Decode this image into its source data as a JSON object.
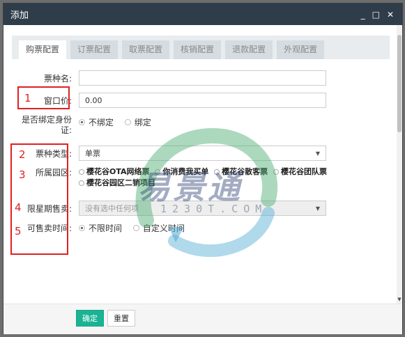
{
  "window": {
    "title": "添加",
    "controls": [
      "_",
      "□",
      "✕"
    ]
  },
  "tabs": [
    {
      "label": "购票配置",
      "active": true
    },
    {
      "label": "订票配置",
      "active": false
    },
    {
      "label": "取票配置",
      "active": false
    },
    {
      "label": "核销配置",
      "active": false
    },
    {
      "label": "退款配置",
      "active": false
    },
    {
      "label": "外观配置",
      "active": false
    }
  ],
  "form": {
    "ticket_name": {
      "label": "票种名:",
      "value": ""
    },
    "window_price": {
      "label": "窗口价:",
      "value": "0.00"
    },
    "bind_id": {
      "label": "是否绑定身份证:",
      "options": [
        "不绑定",
        "绑定"
      ],
      "selected": "不绑定"
    },
    "ticket_type": {
      "label": "票种类型:",
      "value": "单票"
    },
    "park": {
      "label": "所属园区:",
      "options": [
        "樱花谷OTA网络票",
        "你消费我买单",
        "樱花谷散客票",
        "樱花谷团队票",
        "樱花谷园区二销项目"
      ]
    },
    "weekday_limit": {
      "label": "限星期售卖:",
      "placeholder": "没有选中任何项"
    },
    "sale_time": {
      "label": "可售卖时间:",
      "options": [
        "不限时间",
        "自定义时间"
      ],
      "selected": "不限时间"
    }
  },
  "annotations": [
    "1",
    "2",
    "3",
    "4",
    "5"
  ],
  "footer": {
    "confirm": "确定",
    "reset": "重置"
  },
  "watermark": {
    "text": "易景通",
    "sub": "1230T.COM"
  },
  "colors": {
    "titlebar": "#2f3d4a",
    "primary": "#1ab394",
    "annotation": "#e02020"
  }
}
